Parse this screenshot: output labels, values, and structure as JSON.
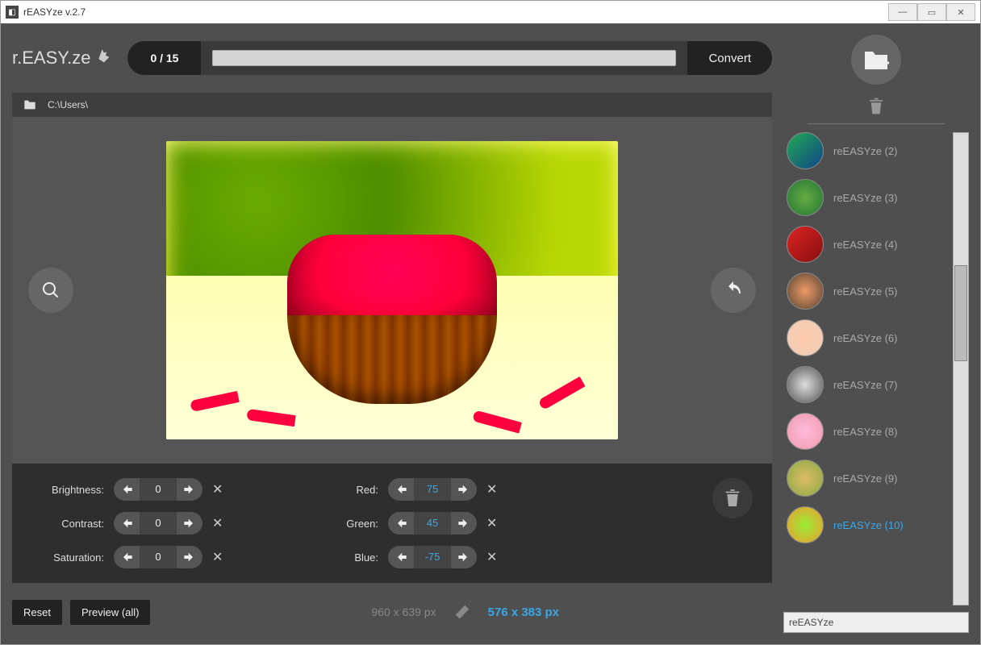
{
  "window": {
    "title": "rEASYze v.2.7"
  },
  "header": {
    "logo": "r.EASY.ze",
    "progress": "0 / 15",
    "convert": "Convert",
    "path": "C:\\Users\\"
  },
  "controls": {
    "left": [
      {
        "label": "Brightness:",
        "value": "0",
        "accent": false
      },
      {
        "label": "Contrast:",
        "value": "0",
        "accent": false
      },
      {
        "label": "Saturation:",
        "value": "0",
        "accent": false
      }
    ],
    "right": [
      {
        "label": "Red:",
        "value": "75",
        "accent": true
      },
      {
        "label": "Green:",
        "value": "45",
        "accent": true
      },
      {
        "label": "Blue:",
        "value": "-75",
        "accent": true
      }
    ]
  },
  "footer": {
    "reset": "Reset",
    "preview_all": "Preview (all)",
    "orig_dim": "960 x 639 px",
    "out_dim": "576 x 383 px"
  },
  "side": {
    "items": [
      {
        "label": "reEASYze (2)",
        "bg": "linear-gradient(135deg,#2a5,#148)"
      },
      {
        "label": "reEASYze (3)",
        "bg": "radial-gradient(circle,#6a4,#273)"
      },
      {
        "label": "reEASYze (4)",
        "bg": "linear-gradient(135deg,#d22,#811)"
      },
      {
        "label": "reEASYze (5)",
        "bg": "radial-gradient(circle,#e96,#543)"
      },
      {
        "label": "reEASYze (6)",
        "bg": "radial-gradient(circle,#fca,#ecb)"
      },
      {
        "label": "reEASYze (7)",
        "bg": "radial-gradient(circle,#ddd,#555)"
      },
      {
        "label": "reEASYze (8)",
        "bg": "radial-gradient(circle,#fbd,#e9a)"
      },
      {
        "label": "reEASYze (9)",
        "bg": "radial-gradient(circle,#db6,#8a4)"
      },
      {
        "label": "reEASYze (10)",
        "bg": "radial-gradient(circle,#9e3,#e93)"
      }
    ],
    "selected_index": 8,
    "input_value": "reEASYze"
  }
}
